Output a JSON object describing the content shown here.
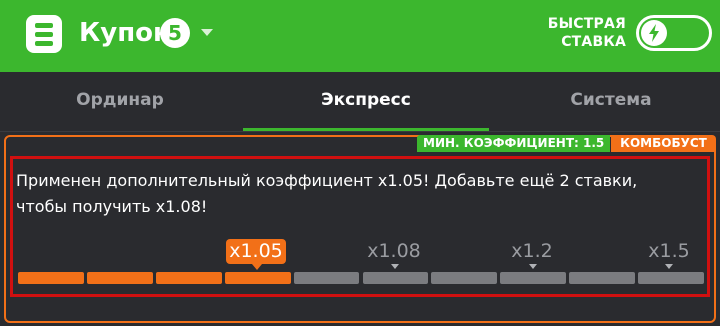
{
  "header": {
    "title": "Купон",
    "coupon_count": "5",
    "fast_bet_label": "БЫСТРАЯ СТАВКА",
    "fast_bet_enabled": false,
    "brand_color": "#3cb72e"
  },
  "tabs": [
    {
      "label": "Ординар",
      "active": false
    },
    {
      "label": "Экспресс",
      "active": true
    },
    {
      "label": "Система",
      "active": false
    }
  ],
  "combo": {
    "min_coef_badge": "МИН. КОЭФФИЦИЕНТ: 1.5",
    "combo_badge": "КОМБОБУСТ",
    "message_line1": "Применен дополнительный коэффициент x1.05! Добавьте ещё 2 ставки,",
    "message_line2": "чтобы получить x1.08!",
    "marks": [
      {
        "label": "x1.05",
        "active": true
      },
      {
        "label": "x1.08",
        "active": false
      },
      {
        "label": "x1.2",
        "active": false
      },
      {
        "label": "x1.5",
        "active": false
      }
    ],
    "progress": {
      "filled_segments": 4,
      "total_segments": 10
    },
    "accent_color": "#f27018",
    "inactive_color": "#7b7c80"
  }
}
